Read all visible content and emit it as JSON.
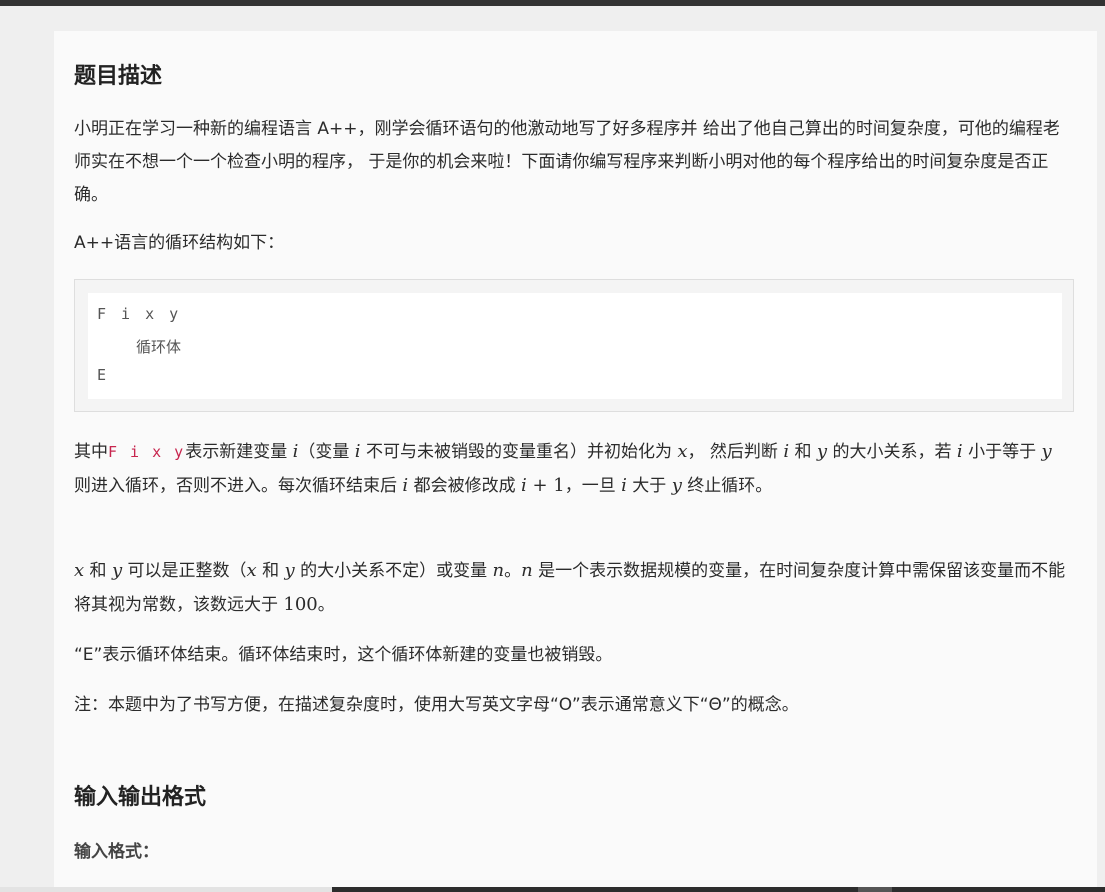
{
  "section1": {
    "heading": "题目描述",
    "p1": "小明正在学习一种新的编程语言 A++，刚学会循环语句的他激动地写了好多程序并 给出了他自己算出的时间复杂度，可他的编程老师实在不想一个一个检查小明的程序， 于是你的机会来啦！下面请你编写程序来判断小明对他的每个程序给出的时间复杂度是否正确。",
    "p2": "A++语言的循环结构如下：",
    "code": {
      "line1": "F i x y",
      "line2": "循环体",
      "line3": "E"
    },
    "p3": {
      "t1": "其中",
      "code": "F i x y",
      "t2": "表示新建变量 ",
      "v_i1": "i",
      "t3": "（变量 ",
      "v_i2": "i",
      "t4": " 不可与未被销毁的变量重名）并初始化为 ",
      "v_x": "x",
      "t5": "， 然后判断 ",
      "v_i3": "i",
      "t6": " 和 ",
      "v_y1": "y",
      "t7": " 的大小关系，若 ",
      "v_i4": "i",
      "t8": " 小于等于 ",
      "v_y2": "y",
      "t9": " 则进入循环，否则不进入。每次循环结束后 ",
      "v_i5": "i",
      "t10": " 都会被修改成 ",
      "v_i6": "i",
      "t11": " + ",
      "n_1": "1",
      "t12": "，一旦 ",
      "v_i7": "i",
      "t13": " 大于 ",
      "v_y3": "y",
      "t14": " 终止循环。"
    },
    "p4": {
      "v_x1": "x",
      "t1": " 和 ",
      "v_y1": "y",
      "t2": " 可以是正整数（",
      "v_x2": "x",
      "t3": " 和 ",
      "v_y2": "y",
      "t4": " 的大小关系不定）或变量 ",
      "v_n1": "n",
      "t5": "。",
      "v_n2": "n",
      "t6": " 是一个表示数据规模的变量，在时间复杂度计算中需保留该变量而不能将其视为常数，该数远大于 ",
      "n_100": "100",
      "t7": "。"
    },
    "p5": "“E”表示循环体结束。循环体结束时，这个循环体新建的变量也被销毁。",
    "p6": "注：本题中为了书写方便，在描述复杂度时，使用大写英文字母“O”表示通常意义下“Θ”的概念。"
  },
  "section2": {
    "heading": "输入输出格式",
    "subheading": "输入格式："
  }
}
